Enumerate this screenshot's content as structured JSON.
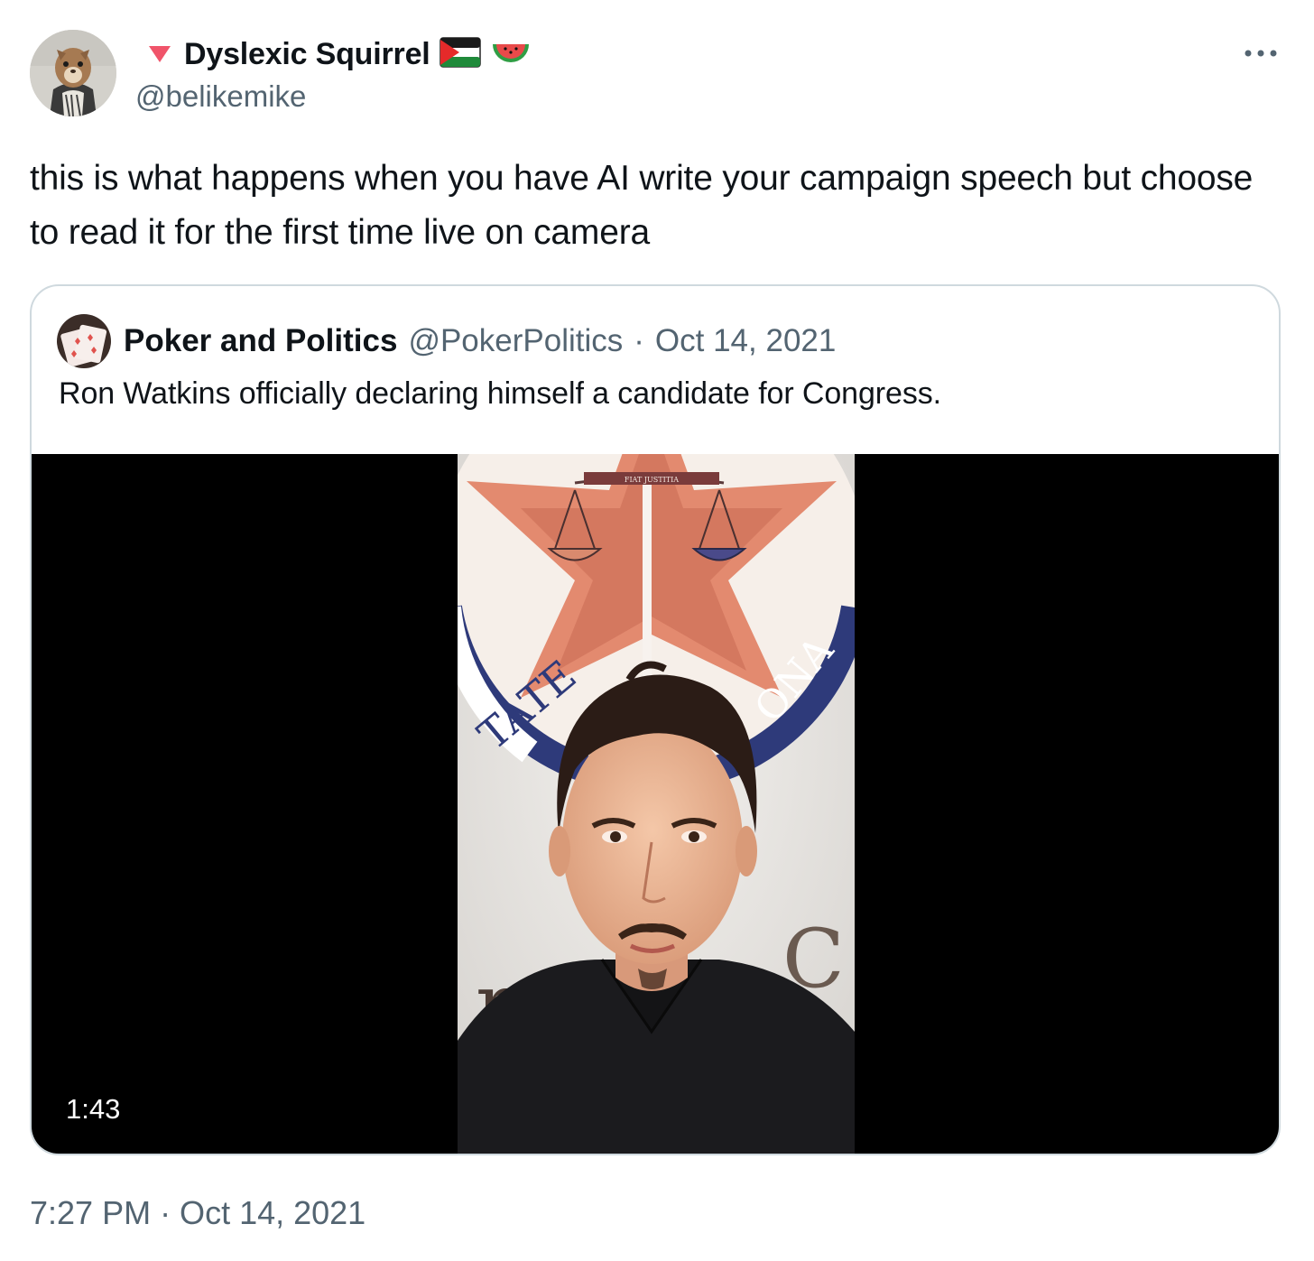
{
  "author": {
    "display_name": "Dyslexic Squirrel",
    "handle": "@belikemike",
    "badge_icons": [
      "red-triangle-icon",
      "palestine-flag-icon",
      "watermelon-icon"
    ]
  },
  "tweet": {
    "text": "this is what happens when you have AI write your campaign speech but choose to read it for the first time live on camera",
    "timestamp": "7:27 PM · Oct 14, 2021"
  },
  "quoted_tweet": {
    "display_name": "Poker and Politics",
    "handle": "@PokerPolitics",
    "separator": "·",
    "date": "Oct 14, 2021",
    "text": "Ron Watkins officially declaring himself a candidate for Congress.",
    "video": {
      "duration": "1:43",
      "seal_top_text": "FIAT JUSTITIA",
      "seal_left_text": "TATE",
      "seal_right_text": "ONA"
    }
  },
  "colors": {
    "text_primary": "#0f1419",
    "text_secondary": "#536471",
    "border": "#cfd9de",
    "badge_red": "#f0546a"
  }
}
